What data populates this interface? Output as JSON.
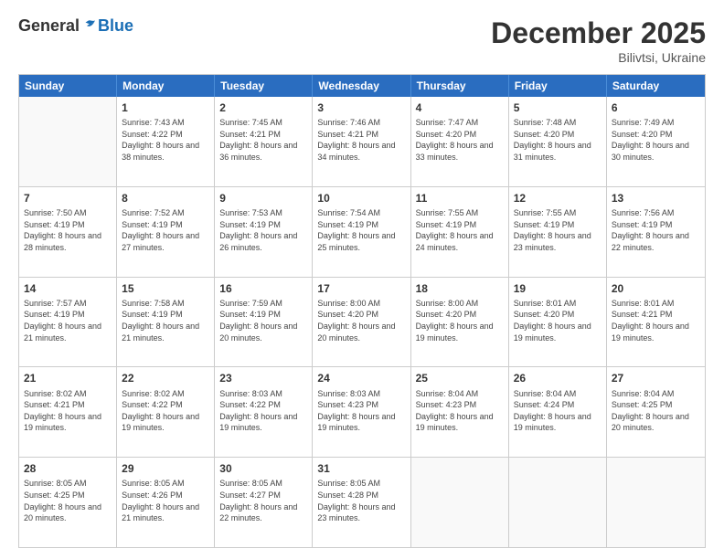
{
  "header": {
    "logo_general": "General",
    "logo_blue": "Blue",
    "month_title": "December 2025",
    "location": "Bilivtsi, Ukraine"
  },
  "weekdays": [
    "Sunday",
    "Monday",
    "Tuesday",
    "Wednesday",
    "Thursday",
    "Friday",
    "Saturday"
  ],
  "rows": [
    [
      {
        "num": "",
        "empty": true
      },
      {
        "num": "1",
        "sunrise": "7:43 AM",
        "sunset": "4:22 PM",
        "daylight": "8 hours and 38 minutes."
      },
      {
        "num": "2",
        "sunrise": "7:45 AM",
        "sunset": "4:21 PM",
        "daylight": "8 hours and 36 minutes."
      },
      {
        "num": "3",
        "sunrise": "7:46 AM",
        "sunset": "4:21 PM",
        "daylight": "8 hours and 34 minutes."
      },
      {
        "num": "4",
        "sunrise": "7:47 AM",
        "sunset": "4:20 PM",
        "daylight": "8 hours and 33 minutes."
      },
      {
        "num": "5",
        "sunrise": "7:48 AM",
        "sunset": "4:20 PM",
        "daylight": "8 hours and 31 minutes."
      },
      {
        "num": "6",
        "sunrise": "7:49 AM",
        "sunset": "4:20 PM",
        "daylight": "8 hours and 30 minutes."
      }
    ],
    [
      {
        "num": "7",
        "sunrise": "7:50 AM",
        "sunset": "4:19 PM",
        "daylight": "8 hours and 28 minutes."
      },
      {
        "num": "8",
        "sunrise": "7:52 AM",
        "sunset": "4:19 PM",
        "daylight": "8 hours and 27 minutes."
      },
      {
        "num": "9",
        "sunrise": "7:53 AM",
        "sunset": "4:19 PM",
        "daylight": "8 hours and 26 minutes."
      },
      {
        "num": "10",
        "sunrise": "7:54 AM",
        "sunset": "4:19 PM",
        "daylight": "8 hours and 25 minutes."
      },
      {
        "num": "11",
        "sunrise": "7:55 AM",
        "sunset": "4:19 PM",
        "daylight": "8 hours and 24 minutes."
      },
      {
        "num": "12",
        "sunrise": "7:55 AM",
        "sunset": "4:19 PM",
        "daylight": "8 hours and 23 minutes."
      },
      {
        "num": "13",
        "sunrise": "7:56 AM",
        "sunset": "4:19 PM",
        "daylight": "8 hours and 22 minutes."
      }
    ],
    [
      {
        "num": "14",
        "sunrise": "7:57 AM",
        "sunset": "4:19 PM",
        "daylight": "8 hours and 21 minutes."
      },
      {
        "num": "15",
        "sunrise": "7:58 AM",
        "sunset": "4:19 PM",
        "daylight": "8 hours and 21 minutes."
      },
      {
        "num": "16",
        "sunrise": "7:59 AM",
        "sunset": "4:19 PM",
        "daylight": "8 hours and 20 minutes."
      },
      {
        "num": "17",
        "sunrise": "8:00 AM",
        "sunset": "4:20 PM",
        "daylight": "8 hours and 20 minutes."
      },
      {
        "num": "18",
        "sunrise": "8:00 AM",
        "sunset": "4:20 PM",
        "daylight": "8 hours and 19 minutes."
      },
      {
        "num": "19",
        "sunrise": "8:01 AM",
        "sunset": "4:20 PM",
        "daylight": "8 hours and 19 minutes."
      },
      {
        "num": "20",
        "sunrise": "8:01 AM",
        "sunset": "4:21 PM",
        "daylight": "8 hours and 19 minutes."
      }
    ],
    [
      {
        "num": "21",
        "sunrise": "8:02 AM",
        "sunset": "4:21 PM",
        "daylight": "8 hours and 19 minutes."
      },
      {
        "num": "22",
        "sunrise": "8:02 AM",
        "sunset": "4:22 PM",
        "daylight": "8 hours and 19 minutes."
      },
      {
        "num": "23",
        "sunrise": "8:03 AM",
        "sunset": "4:22 PM",
        "daylight": "8 hours and 19 minutes."
      },
      {
        "num": "24",
        "sunrise": "8:03 AM",
        "sunset": "4:23 PM",
        "daylight": "8 hours and 19 minutes."
      },
      {
        "num": "25",
        "sunrise": "8:04 AM",
        "sunset": "4:23 PM",
        "daylight": "8 hours and 19 minutes."
      },
      {
        "num": "26",
        "sunrise": "8:04 AM",
        "sunset": "4:24 PM",
        "daylight": "8 hours and 19 minutes."
      },
      {
        "num": "27",
        "sunrise": "8:04 AM",
        "sunset": "4:25 PM",
        "daylight": "8 hours and 20 minutes."
      }
    ],
    [
      {
        "num": "28",
        "sunrise": "8:05 AM",
        "sunset": "4:25 PM",
        "daylight": "8 hours and 20 minutes."
      },
      {
        "num": "29",
        "sunrise": "8:05 AM",
        "sunset": "4:26 PM",
        "daylight": "8 hours and 21 minutes."
      },
      {
        "num": "30",
        "sunrise": "8:05 AM",
        "sunset": "4:27 PM",
        "daylight": "8 hours and 22 minutes."
      },
      {
        "num": "31",
        "sunrise": "8:05 AM",
        "sunset": "4:28 PM",
        "daylight": "8 hours and 23 minutes."
      },
      {
        "num": "",
        "empty": true
      },
      {
        "num": "",
        "empty": true
      },
      {
        "num": "",
        "empty": true
      }
    ]
  ]
}
